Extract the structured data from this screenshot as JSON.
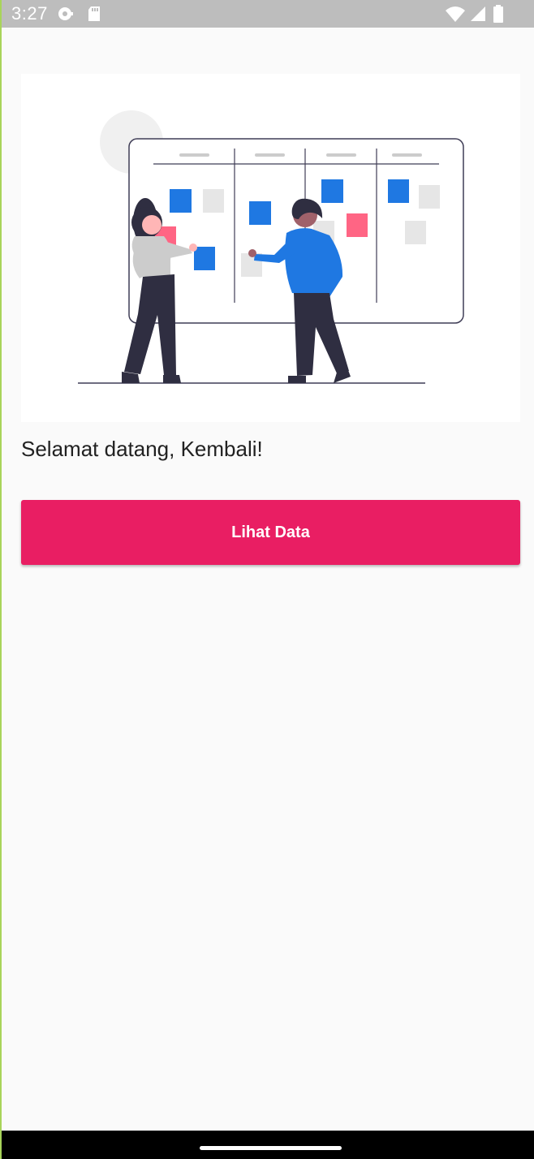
{
  "status_bar": {
    "time": "3:27",
    "left_icons": [
      "notification-dot-icon",
      "sd-card-icon"
    ],
    "right_icons": [
      "wifi-icon",
      "signal-icon",
      "battery-icon"
    ]
  },
  "main": {
    "greeting": "Selamat datang, Kembali!",
    "button_label": "Lihat Data"
  },
  "colors": {
    "accent": "#e91e63",
    "sticky_blue": "#1f78e2",
    "sticky_pink": "#ff6584",
    "sticky_gray": "#e6e6e6",
    "figure_dark": "#2f2e41",
    "status_bar": "#bdbdbd"
  }
}
